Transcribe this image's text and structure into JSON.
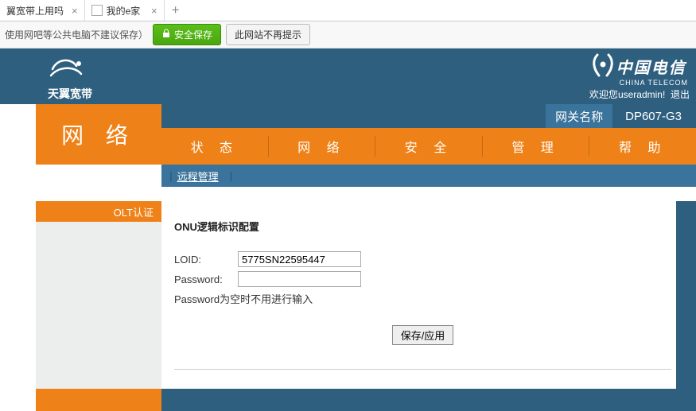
{
  "tabs": [
    {
      "title": "翼宽带上用吗",
      "closable": true,
      "has_icon": false
    },
    {
      "title": "我的e家",
      "closable": true,
      "has_icon": true
    }
  ],
  "save_bar": {
    "hint": "使用网吧等公共电脑不建议保存）",
    "save_label": "安全保存",
    "dismiss_label": "此网站不再提示"
  },
  "brand": {
    "name": "天翼宽带"
  },
  "telecom": {
    "name": "中国电信",
    "sub": "CHINA TELECOM"
  },
  "welcome": {
    "prefix": "欢迎您",
    "user": "useradmin",
    "logout": "退出"
  },
  "gateway": {
    "label": "网关名称",
    "value": "DP607-G3"
  },
  "nav": [
    {
      "label": "状 态"
    },
    {
      "label": "网 络"
    },
    {
      "label": "安 全"
    },
    {
      "label": "管 理"
    },
    {
      "label": "帮 助"
    }
  ],
  "subnav": {
    "item": "远程管理"
  },
  "sidebar": {
    "title": "OLT认证"
  },
  "form": {
    "title": "ONU逻辑标识配置",
    "loid_label": "LOID:",
    "loid_value": "5775SN22595447",
    "password_label": "Password:",
    "password_value": "",
    "note": "Password为空时不用进行输入",
    "apply_label": "保存/应用"
  }
}
